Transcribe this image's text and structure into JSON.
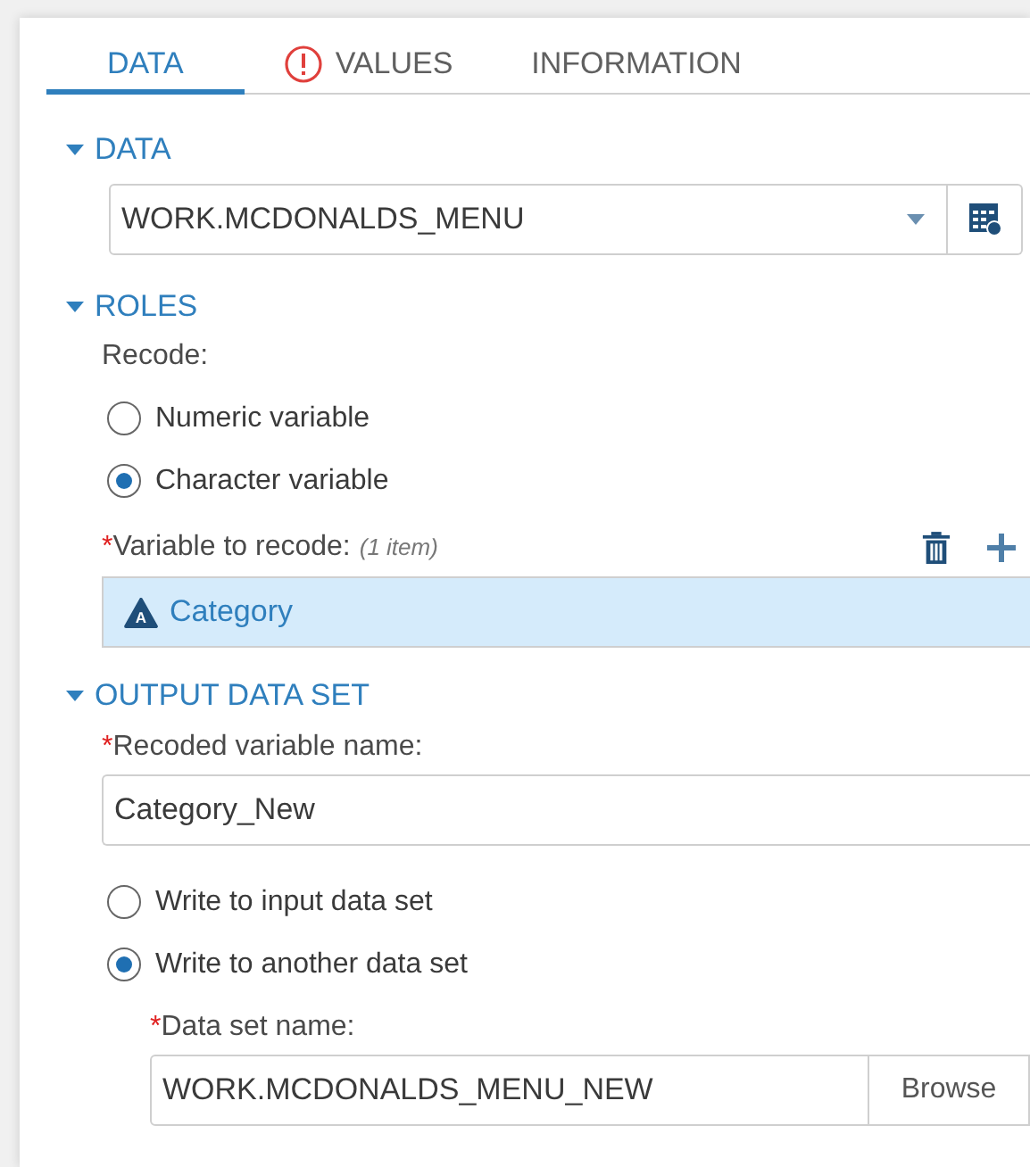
{
  "tabs": [
    {
      "label": "DATA",
      "selected": true,
      "error": false
    },
    {
      "label": "VALUES",
      "selected": false,
      "error": true
    },
    {
      "label": "INFORMATION",
      "selected": false,
      "error": false
    }
  ],
  "sections": [
    {
      "title": "DATA",
      "expanded": true,
      "items": [
        {
          "kind": "combo",
          "value": "WORK.MCDONALDS_MENU"
        }
      ]
    },
    {
      "title": "ROLES",
      "expanded": true,
      "items": [
        {
          "kind": "label",
          "text": "Recode:"
        },
        {
          "kind": "radios",
          "options": [
            {
              "label": "Numeric variable",
              "selected": false
            },
            {
              "label": "Character variable",
              "selected": true
            }
          ]
        },
        {
          "kind": "varlist",
          "required_mark": "*",
          "label": "Variable to recode:",
          "hint": "(1 item)",
          "items": [
            {
              "name": "Category",
              "type_glyph": "A",
              "selected": true
            }
          ]
        }
      ]
    },
    {
      "title": "OUTPUT DATA SET",
      "expanded": true,
      "items": [
        {
          "kind": "text",
          "required_mark": "*",
          "label": "Recoded variable name:",
          "value": "Category_New"
        },
        {
          "kind": "radios",
          "options": [
            {
              "label": "Write to input data set",
              "selected": false
            },
            {
              "label": "Write to another data set",
              "selected": true
            }
          ]
        },
        {
          "kind": "browse",
          "required_mark": "*",
          "label": "Data set name:",
          "value": "WORK.MCDONALDS_MENU_NEW",
          "button": "Browse"
        }
      ]
    }
  ]
}
